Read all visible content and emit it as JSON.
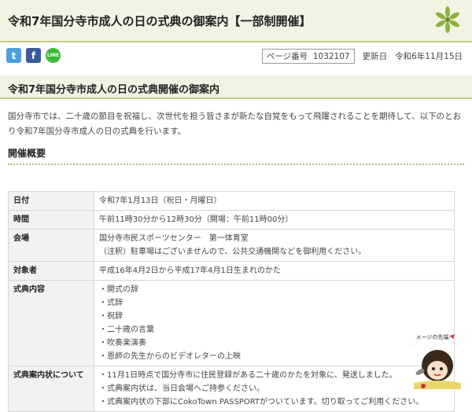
{
  "header": {
    "title": "令和7年国分寺市成人の日の式典の御案内【一部制開催】"
  },
  "share": {
    "twitter": "t",
    "facebook": "f",
    "line": "LINE"
  },
  "meta": {
    "page_no_label": "ページ番号",
    "page_no": "1032107",
    "updated_label": "更新日",
    "updated": "令和6年11月15日"
  },
  "section": {
    "title": "令和7年国分寺市成人の日の式典開催の御案内"
  },
  "intro": "国分寺市では、二十歳の節目を祝福し、次世代を担う皆さまが新たな自覚をもって飛躍されることを期待して、以下のとおり令和7年国分寺市成人の日の式典を行います。",
  "overview": {
    "heading": "開催概要"
  },
  "table": {
    "rows": [
      {
        "key": "日付",
        "lines": [
          "令和7年1月13日（祝日・月曜日）"
        ]
      },
      {
        "key": "時間",
        "lines": [
          "午前11時30分から12時30分（開場：午前11時00分）"
        ]
      },
      {
        "key": "会場",
        "lines": [
          "国分寺市民スポーツセンター　第一体育室",
          "（注釈）駐車場はございませんので、公共交通機関などを御利用ください。"
        ]
      },
      {
        "key": "対象者",
        "lines": [
          "平成16年4月2日から平成17年4月1日生まれのかた"
        ]
      },
      {
        "key": "式典内容",
        "lines": [
          "・開式の辞",
          "・式辞",
          "・祝辞",
          "・二十歳の言葉",
          "・吹奏楽演奏",
          "・恩師の先生からのビデオレターの上映"
        ]
      },
      {
        "key": "式典案内状について",
        "lines": [
          "・11月1日時点で国分寺市に住民登録がある二十歳のかたを対象に、発送しました。",
          "・式典案内状は、当日会場へご持参ください。",
          "・式典案内状の下部にCokoTown PASSPORTがついています。切り取ってご利用ください。"
        ]
      }
    ]
  },
  "mascot": {
    "caption": "メージの先端へ"
  },
  "colors": {
    "title_bg": "#f3f3e3",
    "rule": "#c8c88a",
    "table_key_bg": "#f2f2f2",
    "twitter": "#4a9fdc",
    "facebook": "#3b5998",
    "line": "#3cba3c"
  }
}
